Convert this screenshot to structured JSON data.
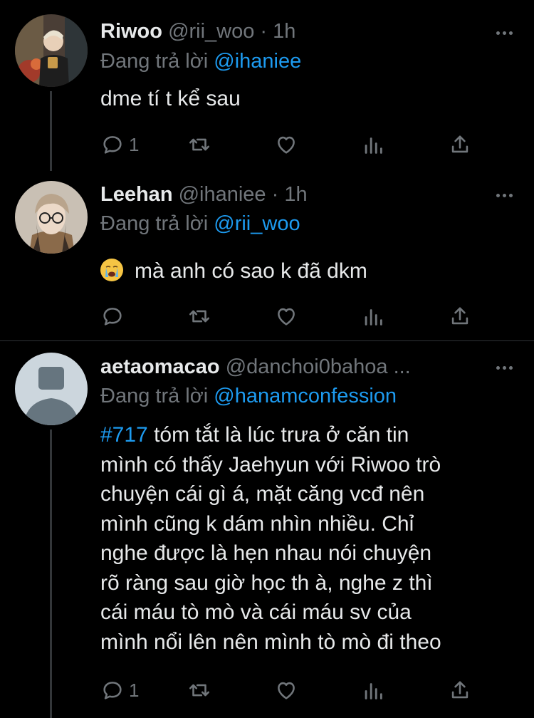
{
  "tweets": [
    {
      "name": "Riwoo",
      "handle": "@rii_woo · 1h",
      "replying_prefix": "Đang trả lời",
      "replying_to": "@ihaniee",
      "text": "dme tí t kể sau",
      "reply_count": "1"
    },
    {
      "name": "Leehan",
      "handle": "@ihaniee · 1h",
      "replying_prefix": "Đang trả lời",
      "replying_to": "@rii_woo",
      "text": "mà anh có sao k đã dkm",
      "emoji": "loudly-crying-face",
      "reply_count": ""
    },
    {
      "name": "aetaomacao",
      "handle": "@danchoi0bahoa ...",
      "replying_prefix": "Đang trả lời",
      "replying_to": "@hanamconfession",
      "hashtag": "#717",
      "text_lines": [
        " tóm tắt là lúc trưa ở căn tin",
        "mình có thấy Jaehyun với Riwoo trò",
        "chuyện cái gì á, mặt căng vcđ nên",
        "mình cũng k dám nhìn nhiều. Chỉ",
        "nghe được là hẹn nhau nói chuyện",
        "rõ ràng sau giờ học th à, nghe z thì",
        "cái máu tò mò và cái máu sv của",
        "mình nổi lên nên mình tò mò đi theo"
      ],
      "reply_count": "1"
    }
  ],
  "colors": {
    "background": "#000000",
    "text": "#e7e9ea",
    "muted": "#71767b",
    "accent": "#1d9bf0"
  },
  "icons": [
    "reply-icon",
    "retweet-icon",
    "like-icon",
    "analytics-icon",
    "share-icon",
    "more-icon"
  ]
}
